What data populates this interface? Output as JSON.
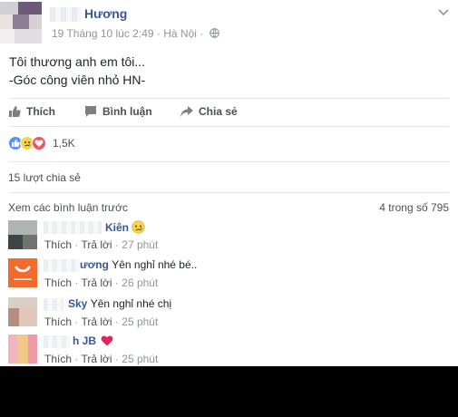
{
  "post": {
    "author": "Hương",
    "timestamp": "19 Tháng 10 lúc 2:49",
    "separator": "·",
    "location": "Hà Nội",
    "separator2": "·",
    "line1": "Tôi thương anh em tôi...",
    "line2": "-Góc công viên nhỏ HN-"
  },
  "actions": {
    "like": "Thích",
    "comment": "Bình luận",
    "share": "Chia sẻ"
  },
  "reactions": {
    "count": "1,5K",
    "types": [
      "like-icon",
      "sad-icon",
      "love-icon"
    ]
  },
  "shares": "15 lượt chia sẻ",
  "comments_header": {
    "prev_label": "Xem các bình luận trước",
    "counter": "4 trong số 795"
  },
  "comments": [
    {
      "name": "Kiên",
      "text": "",
      "like": "Thích",
      "dot": "·",
      "reply": "Trả lời",
      "time": "27 phút"
    },
    {
      "name": "ương",
      "text": "Yên nghỉ nhé bé..",
      "like": "Thích",
      "dot": "·",
      "reply": "Trả lời",
      "time": "26 phút"
    },
    {
      "name": "Sky",
      "text": "Yên nghỉ nhé chị",
      "like": "Thích",
      "dot": "·",
      "reply": "Trả lời",
      "time": "25 phút"
    },
    {
      "name": "h JB",
      "text": "",
      "like": "Thích",
      "dot": "·",
      "reply": "Trả lời",
      "time": "25 phút"
    }
  ],
  "colors": {
    "link": "#365899",
    "meta": "#90949c",
    "like_blue": "#5890ff",
    "love_red": "#f25268",
    "sad_yellow": "#fcd34d"
  }
}
